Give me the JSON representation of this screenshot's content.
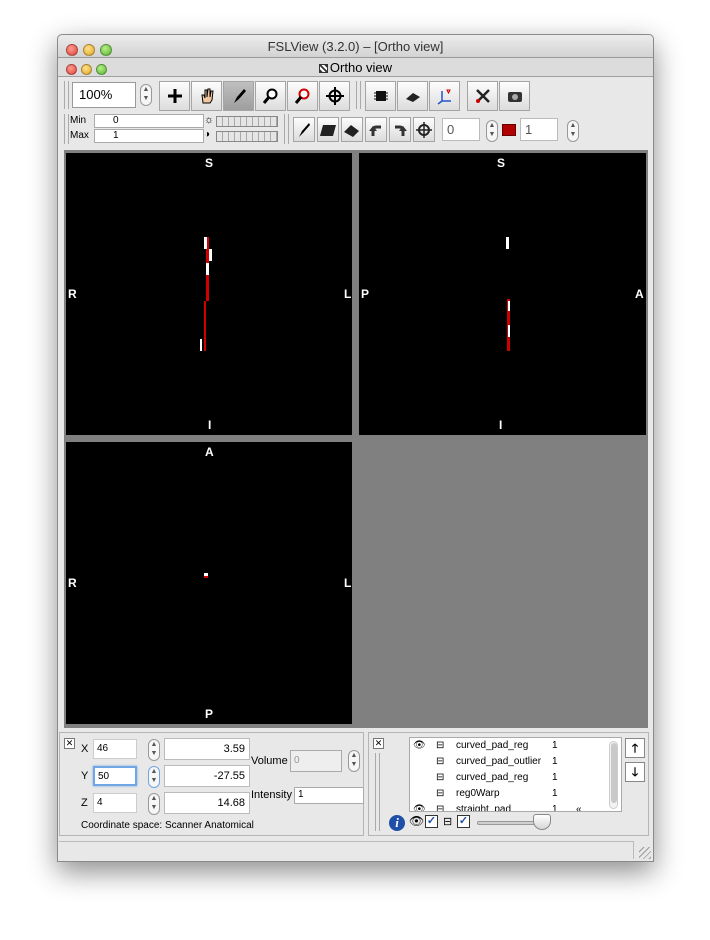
{
  "window": {
    "title": "FSLView (3.2.0) – [Ortho view]",
    "subtitle": "Ortho view"
  },
  "toolbar": {
    "zoom": "100%"
  },
  "display": {
    "min_label": "Min",
    "min_value": "0",
    "max_label": "Max",
    "max_value": "1",
    "value_a": "0",
    "value_b": "1",
    "accent_color": "#b00000"
  },
  "views": {
    "coronal": {
      "top": "S",
      "bottom": "I",
      "left": "R",
      "right": "L"
    },
    "sagittal": {
      "top": "S",
      "bottom": "I",
      "left": "P",
      "right": "A"
    },
    "axial": {
      "top": "A",
      "bottom": "P",
      "left": "R",
      "right": "L"
    }
  },
  "cursor": {
    "x_label": "X",
    "x_voxel": "46",
    "x_mm": "3.59",
    "y_label": "Y",
    "y_voxel": "50",
    "y_mm": "-27.55",
    "z_label": "Z",
    "z_voxel": "4",
    "z_mm": "14.68",
    "volume_label": "Volume",
    "volume_value": "0",
    "intensity_label": "Intensity",
    "intensity_value": "1",
    "coordinate_space": "Coordinate space: Scanner Anatomical"
  },
  "layers": [
    {
      "name": "curved_pad_reg",
      "value": "1",
      "visible": true
    },
    {
      "name": "curved_pad_outlier",
      "value": "1",
      "visible": false
    },
    {
      "name": "curved_pad_reg",
      "value": "1",
      "visible": false
    },
    {
      "name": "reg0Warp",
      "value": "1",
      "visible": false
    },
    {
      "name": "straight_pad",
      "value": "1",
      "visible": true
    }
  ],
  "icons": [
    "plus-icon",
    "hand-icon",
    "pencil-icon",
    "magnifier-icon",
    "zoom-out-icon",
    "crosshair-icon",
    "chip-icon",
    "layer-icon",
    "axes-icon",
    "tools-icon",
    "camera-icon",
    "info-icon",
    "eye-icon",
    "lock-icon"
  ]
}
